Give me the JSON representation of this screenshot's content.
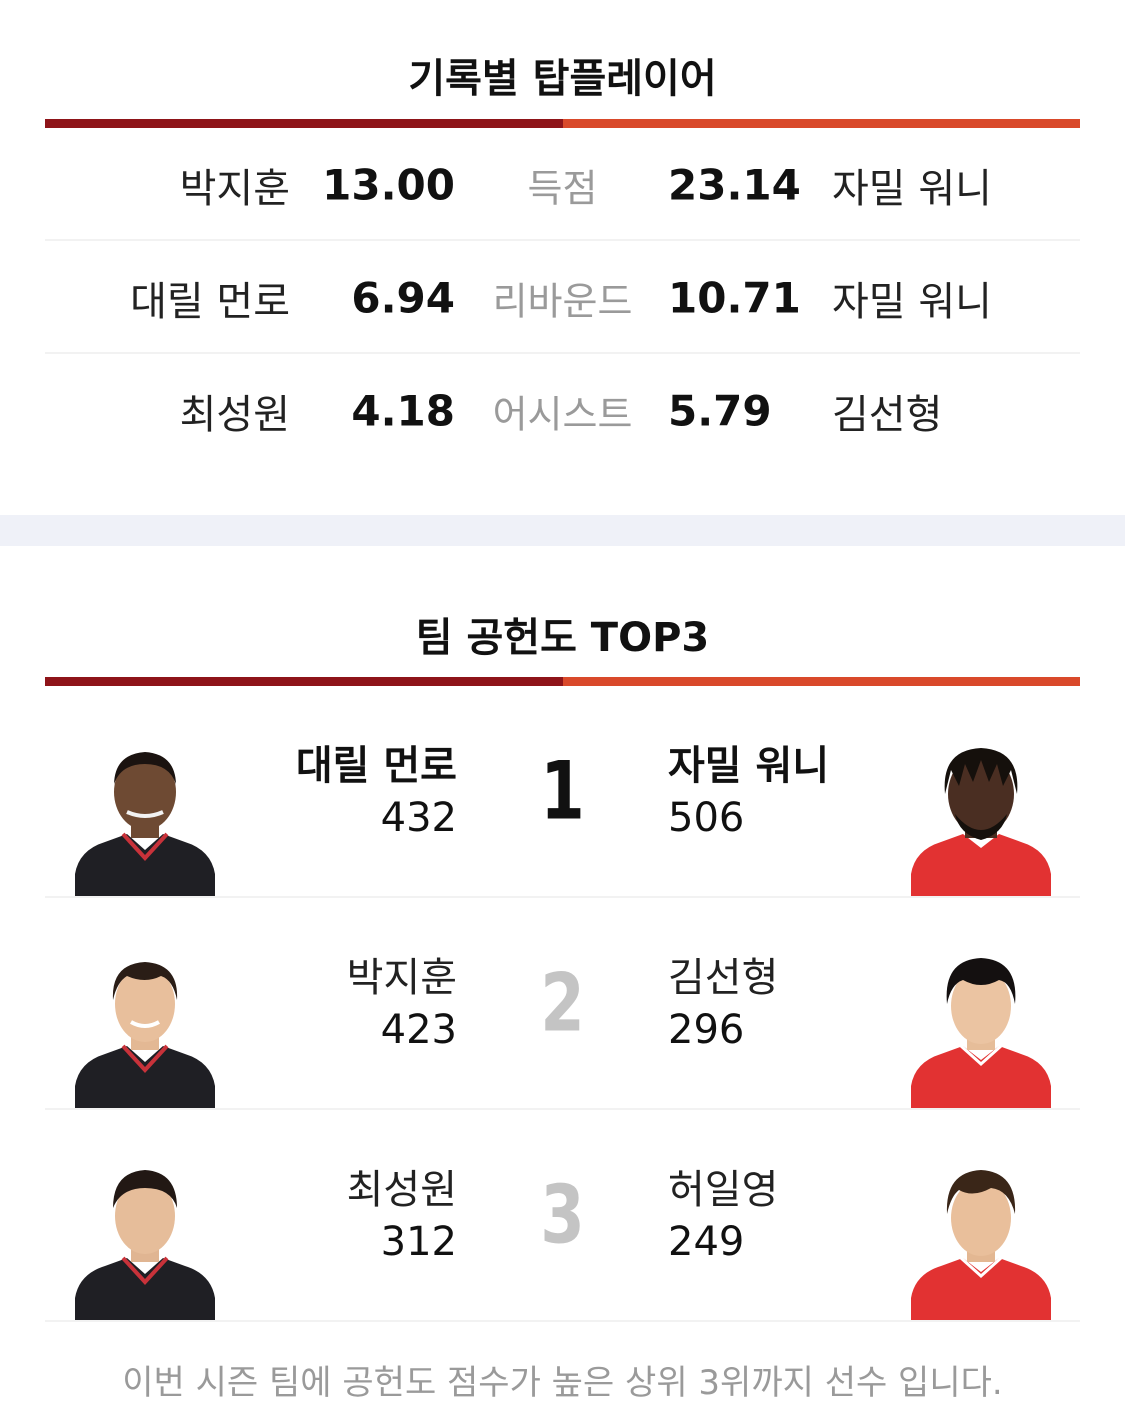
{
  "record_section": {
    "title": "기록별 탑플레이어",
    "rows": [
      {
        "left_name": "박지훈",
        "left_value": "13.00",
        "category": "득점",
        "right_value": "23.14",
        "right_name": "자밀 워니"
      },
      {
        "left_name": "대릴 먼로",
        "left_value": "6.94",
        "category": "리바운드",
        "right_value": "10.71",
        "right_name": "자밀 워니"
      },
      {
        "left_name": "최성원",
        "left_value": "4.18",
        "category": "어시스트",
        "right_value": "5.79",
        "right_name": "김선형"
      }
    ]
  },
  "contribution_section": {
    "title": "팀 공헌도 TOP3",
    "rows": [
      {
        "rank": "1",
        "left_name": "대릴 먼로",
        "left_score": "432",
        "right_name": "자밀 워니",
        "right_score": "506"
      },
      {
        "rank": "2",
        "left_name": "박지훈",
        "left_score": "423",
        "right_name": "김선형",
        "right_score": "296"
      },
      {
        "rank": "3",
        "left_name": "최성원",
        "left_score": "312",
        "right_name": "허일영",
        "right_score": "249"
      }
    ],
    "footnote": "이번 시즌 팀에 공헌도 점수가 높은 상위 3위까지 선수 입니다."
  },
  "colors": {
    "left_team": "#8e1419",
    "right_team": "#d9492a",
    "left_jersey": "#1f1f24",
    "right_jersey": "#e23232",
    "band": "#eff1f8"
  }
}
